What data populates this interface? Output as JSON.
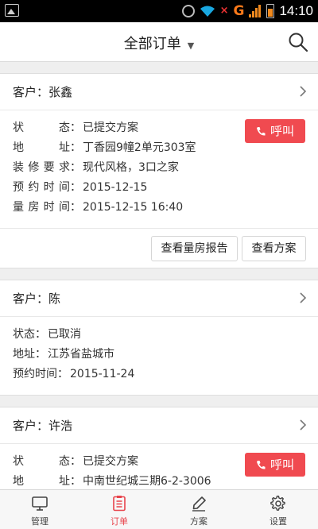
{
  "status_bar": {
    "time": "14:10",
    "carrier": "G"
  },
  "header": {
    "title": "全部订单",
    "dropdown": "▼"
  },
  "orders": [
    {
      "customer_label": "客户：",
      "customer": "张鑫",
      "call_label": "呼叫",
      "rows": [
        {
          "label": "状态",
          "value": "已提交方案"
        },
        {
          "label": "地址",
          "value": "丁香园9幢2单元303室"
        },
        {
          "label": "装修要求",
          "value": "现代风格，3口之家"
        },
        {
          "label": "预约时间",
          "value": "2015-12-15"
        },
        {
          "label": "量房时间",
          "value": "2015-12-15 16:40"
        }
      ],
      "actions": [
        "查看量房报告",
        "查看方案"
      ]
    },
    {
      "customer_label": "客户：",
      "customer": "陈",
      "rows": [
        {
          "label": "状态",
          "value": "已取消"
        },
        {
          "label": "地址",
          "value": "江苏省盐城市"
        },
        {
          "label": "预约时间",
          "value": "2015-11-24"
        }
      ]
    },
    {
      "customer_label": "客户：",
      "customer": "许浩",
      "call_label": "呼叫",
      "rows": [
        {
          "label": "状态",
          "value": "已提交方案"
        },
        {
          "label": "地址",
          "value": "中南世纪城三期6-2-3006"
        }
      ]
    }
  ],
  "tabs": [
    {
      "label": "管理",
      "icon": "monitor-icon"
    },
    {
      "label": "订单",
      "icon": "order-list-icon",
      "active": true
    },
    {
      "label": "方案",
      "icon": "edit-icon"
    },
    {
      "label": "设置",
      "icon": "gear-icon"
    }
  ],
  "colors": {
    "accent": "#e8434b",
    "call_button": "#f04a50",
    "background": "#efefef"
  }
}
